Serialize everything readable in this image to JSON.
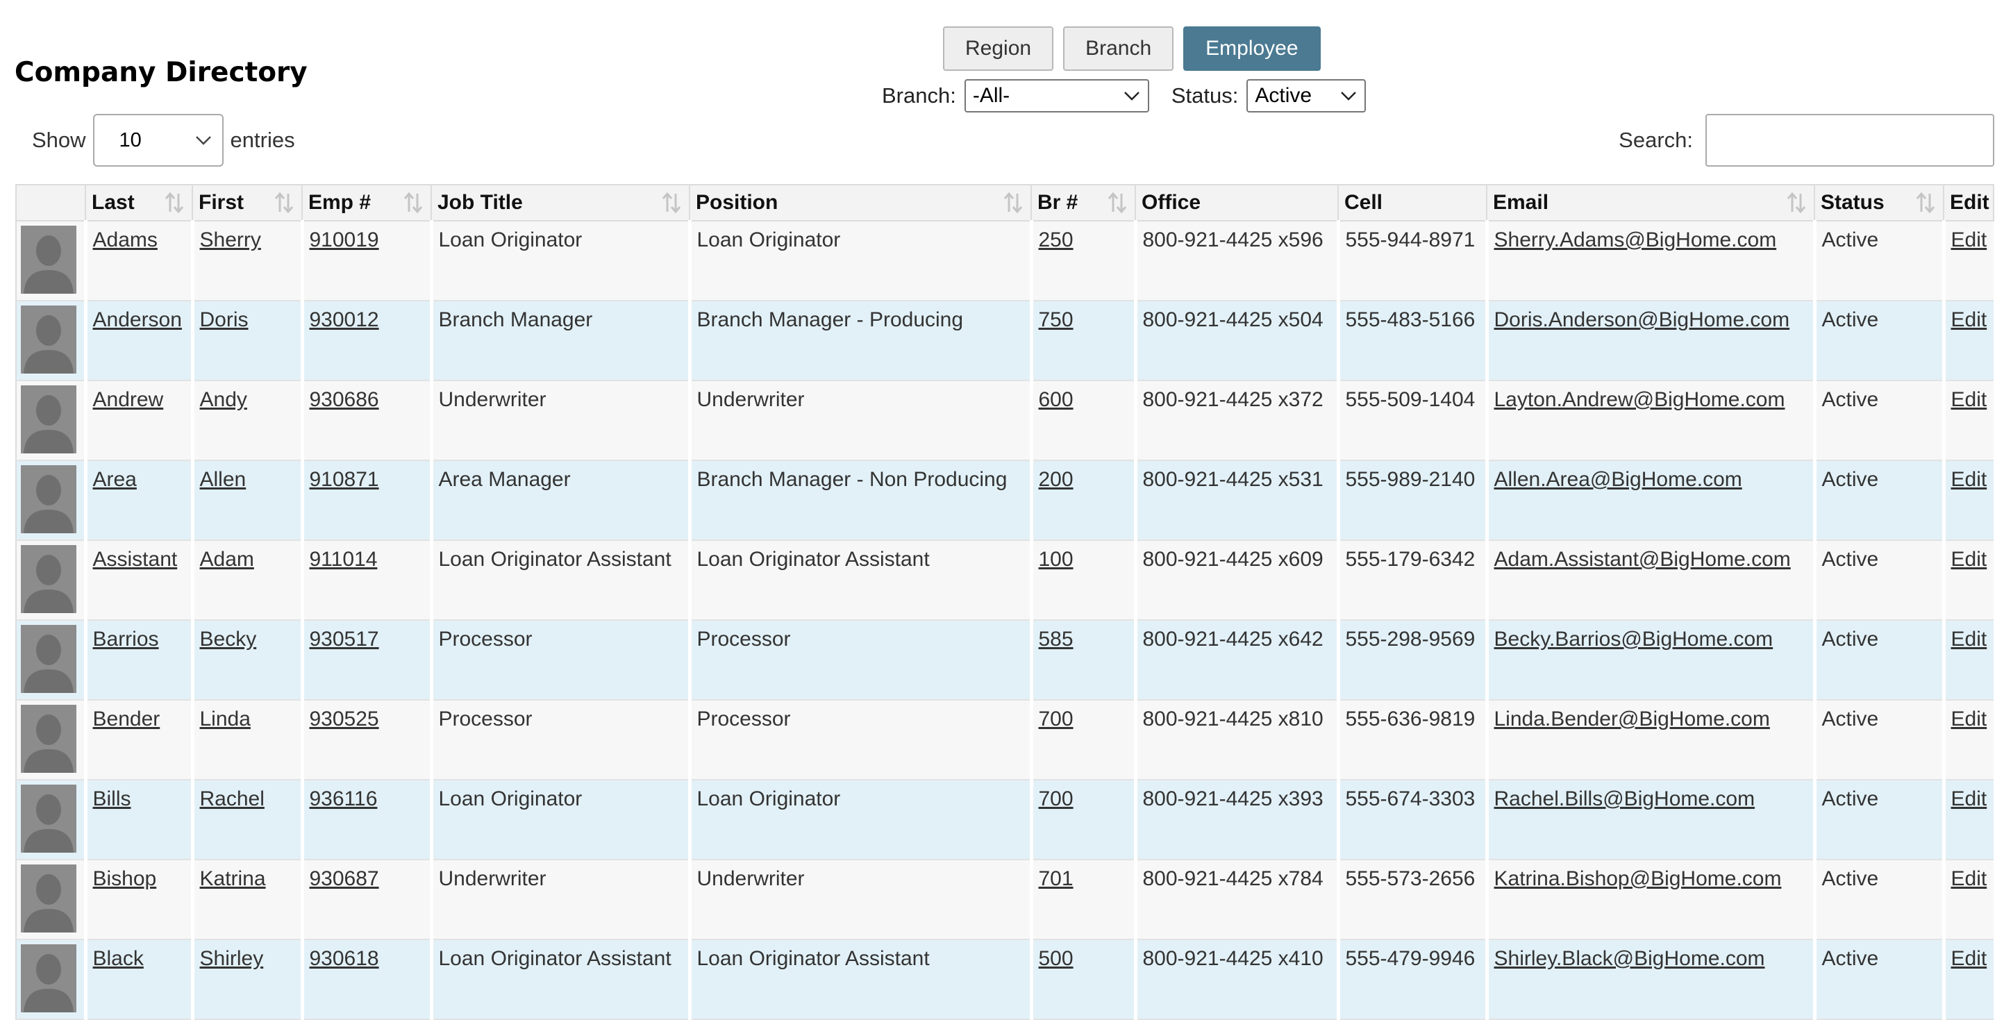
{
  "page": {
    "title": "Company Directory"
  },
  "views": [
    {
      "label": "Region",
      "active": false
    },
    {
      "label": "Branch",
      "active": false
    },
    {
      "label": "Employee",
      "active": true
    }
  ],
  "filters": {
    "branch_label": "Branch:",
    "branch_value": "-All-",
    "status_label": "Status:",
    "status_value": "Active"
  },
  "length": {
    "show_label": "Show",
    "value": "10",
    "entries_label": "entries"
  },
  "search": {
    "label": "Search:",
    "value": ""
  },
  "colors": {
    "accent": "#4b7a92",
    "row_odd": "#f7f7f7",
    "row_even": "#e2f1f7"
  },
  "table": {
    "headers": [
      "",
      "Last",
      "First",
      "Emp #",
      "Job Title",
      "Position",
      "Br #",
      "Office",
      "Cell",
      "Email",
      "Status",
      "Edit"
    ],
    "rows": [
      [
        "Adams",
        "Sherry",
        "910019",
        "Loan Originator",
        "Loan Originator",
        "250",
        "800-921-4425 x596",
        "555-944-8971",
        "Sherry.Adams@BigHome.com",
        "Active",
        "Edit"
      ],
      [
        "Anderson",
        "Doris",
        "930012",
        "Branch Manager",
        "Branch Manager - Producing",
        "750",
        "800-921-4425 x504",
        "555-483-5166",
        "Doris.Anderson@BigHome.com",
        "Active",
        "Edit"
      ],
      [
        "Andrew",
        "Andy",
        "930686",
        "Underwriter",
        "Underwriter",
        "600",
        "800-921-4425 x372",
        "555-509-1404",
        "Layton.Andrew@BigHome.com",
        "Active",
        "Edit"
      ],
      [
        "Area",
        "Allen",
        "910871",
        "Area Manager",
        "Branch Manager - Non Producing",
        "200",
        "800-921-4425 x531",
        "555-989-2140",
        "Allen.Area@BigHome.com",
        "Active",
        "Edit"
      ],
      [
        "Assistant",
        "Adam",
        "911014",
        "Loan Originator Assistant",
        "Loan Originator Assistant",
        "100",
        "800-921-4425 x609",
        "555-179-6342",
        "Adam.Assistant@BigHome.com",
        "Active",
        "Edit"
      ],
      [
        "Barrios",
        "Becky",
        "930517",
        "Processor",
        "Processor",
        "585",
        "800-921-4425 x642",
        "555-298-9569",
        "Becky.Barrios@BigHome.com",
        "Active",
        "Edit"
      ],
      [
        "Bender",
        "Linda",
        "930525",
        "Processor",
        "Processor",
        "700",
        "800-921-4425 x810",
        "555-636-9819",
        "Linda.Bender@BigHome.com",
        "Active",
        "Edit"
      ],
      [
        "Bills",
        "Rachel",
        "936116",
        "Loan Originator",
        "Loan Originator",
        "700",
        "800-921-4425 x393",
        "555-674-3303",
        "Rachel.Bills@BigHome.com",
        "Active",
        "Edit"
      ],
      [
        "Bishop",
        "Katrina",
        "930687",
        "Underwriter",
        "Underwriter",
        "701",
        "800-921-4425 x784",
        "555-573-2656",
        "Katrina.Bishop@BigHome.com",
        "Active",
        "Edit"
      ],
      [
        "Black",
        "Shirley",
        "930618",
        "Loan Originator Assistant",
        "Loan Originator Assistant",
        "500",
        "800-921-4425 x410",
        "555-479-9946",
        "Shirley.Black@BigHome.com",
        "Active",
        "Edit"
      ]
    ]
  }
}
